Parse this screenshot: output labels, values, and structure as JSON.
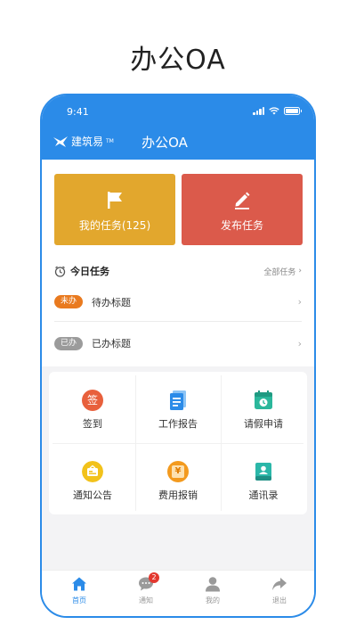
{
  "page": {
    "heading": "办公OA"
  },
  "status": {
    "time": "9:41"
  },
  "header": {
    "brand": "建筑易",
    "brand_mark": "TM",
    "title": "办公OA"
  },
  "tiles": {
    "my_tasks": "我的任务(125)",
    "publish": "发布任务"
  },
  "today": {
    "title": "今日任务",
    "all_link": "全部任务",
    "rows": [
      {
        "tag": "未办",
        "title": "待办标题"
      },
      {
        "tag": "已办",
        "title": "已办标题"
      }
    ]
  },
  "grid": [
    {
      "label": "签到",
      "icon": "sign-in-icon",
      "glyph": "签",
      "color": "#e8603c"
    },
    {
      "label": "工作报告",
      "icon": "report-icon",
      "color": "#2b8be8"
    },
    {
      "label": "请假申请",
      "icon": "leave-icon",
      "color": "#2bb79b"
    },
    {
      "label": "通知公告",
      "icon": "notice-icon",
      "color": "#f2c21b"
    },
    {
      "label": "费用报销",
      "icon": "expense-icon",
      "glyph": "¥",
      "color": "#f39a1e"
    },
    {
      "label": "通讯录",
      "icon": "contacts-icon",
      "color": "#2bb7a9"
    }
  ],
  "tabbar": {
    "items": [
      {
        "label": "首页",
        "icon": "home-icon"
      },
      {
        "label": "通知",
        "icon": "chat-icon",
        "badge": "2"
      },
      {
        "label": "我的",
        "icon": "user-icon"
      },
      {
        "label": "退出",
        "icon": "share-icon"
      }
    ]
  },
  "colors": {
    "primary": "#2b8be8",
    "tasks": "#e2a72d",
    "publish": "#db5a4b",
    "pending": "#e97a1f",
    "done": "#9b9b9b"
  }
}
